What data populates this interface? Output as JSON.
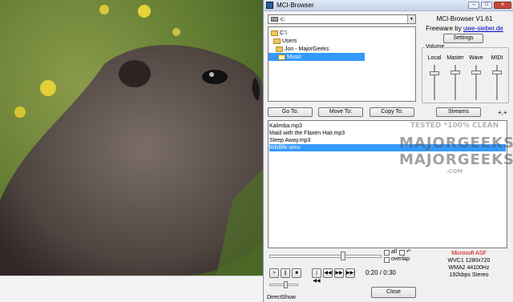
{
  "window": {
    "title": "MCI-Browser"
  },
  "drive": {
    "value": "c:"
  },
  "folders": [
    {
      "label": "C:\\",
      "indent": 0
    },
    {
      "label": "Users",
      "indent": 1
    },
    {
      "label": "Jon - MajorGeeks",
      "indent": 2
    },
    {
      "label": "Music",
      "indent": 3,
      "selected": true
    }
  ],
  "info": {
    "app_name": "MCI-Browser V1.61",
    "freeware_prefix": "Freeware by ",
    "author_link": "uwe-sieber.de",
    "settings_label": "Settings"
  },
  "volume": {
    "group_label": "Volume",
    "channels": [
      {
        "label": "Local",
        "level": 0.8
      },
      {
        "label": "Master",
        "level": 0.82
      },
      {
        "label": "Wave",
        "level": 0.82
      },
      {
        "label": "MIDI",
        "level": 0.82
      }
    ]
  },
  "actions": {
    "go_to": "Go To:",
    "move_to": "Move To:",
    "copy_to": "Copy To:",
    "streams": "Streams",
    "extra": "+,+"
  },
  "files": [
    "Kalimba.mp3",
    "Maid with the Flaxen Hair.mp3",
    "Sleep Away.mp3",
    "Wildlife.wmv"
  ],
  "selected_file_index": 3,
  "player": {
    "position": 0.667,
    "all_label": "all",
    "overlap_label": "overlap",
    "loop_glyph": "↶",
    "buttons": [
      ">",
      "||",
      "■",
      "|◀◀",
      "◀◀",
      "▶▶",
      "▶▶|"
    ],
    "time_current": "0:20",
    "time_sep": "/",
    "time_total": "0:30",
    "volume_level": 0.6,
    "engine": "DirectShow"
  },
  "media_info": {
    "format": "Microsoft ASF",
    "video": "WVC1  1280x720",
    "audio": "WMA2  44100Hz",
    "bitrate": "192kbps  Stereo"
  },
  "close_label": "Close",
  "watermark": {
    "line1": "TESTED *100% CLEAN",
    "line2": "MAJORGEEKS",
    "line3": "MAJORGEEKS",
    "line4": ".COM"
  }
}
